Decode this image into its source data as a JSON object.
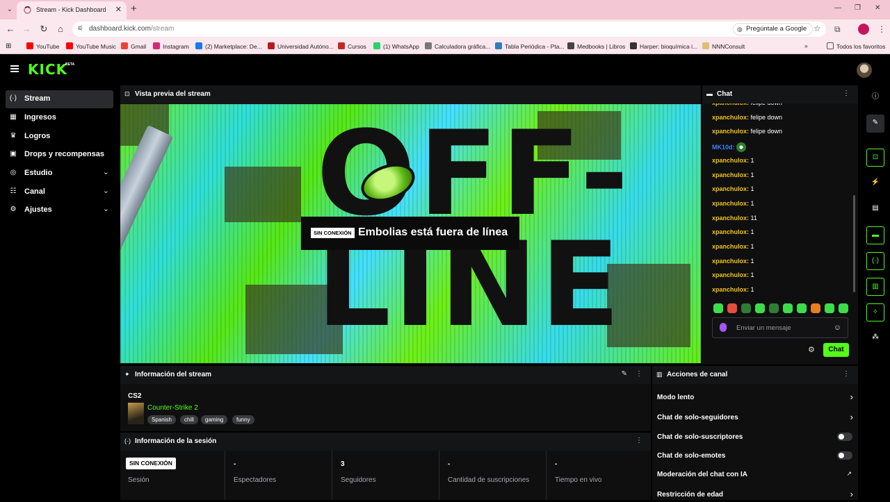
{
  "browser": {
    "tab_title": "Stream - Kick Dashboard",
    "url_host": "dashboard.kick.com",
    "url_path": "/stream",
    "ask_google": "Pregúntale a Google",
    "bookmarks": [
      {
        "label": "YouTube",
        "color": "#ff0000"
      },
      {
        "label": "YouTube Music",
        "color": "#ff0000"
      },
      {
        "label": "Gmail",
        "color": "#ea4335"
      },
      {
        "label": "Instagram",
        "color": "#d62976"
      },
      {
        "label": "(2) Marketplace: De...",
        "color": "#1877f2"
      },
      {
        "label": "Universidad Autóno...",
        "color": "#b71c1c"
      },
      {
        "label": "Cursos",
        "color": "#c62828"
      },
      {
        "label": "(1) WhatsApp",
        "color": "#25d366"
      },
      {
        "label": "Calculadora gráfica...",
        "color": "#777777"
      },
      {
        "label": "Tabla Periódica - Pta...",
        "color": "#2e7dbf"
      },
      {
        "label": "Medbooks | Libros",
        "color": "#444444"
      },
      {
        "label": "Harper: bioquímica i...",
        "color": "#333333"
      },
      {
        "label": "NNNConsult",
        "color": "#e0c070"
      }
    ],
    "all_bookmarks": "Todos los favoritos"
  },
  "app": {
    "logo": "KICK",
    "logo_badge": "BETA",
    "accent": "#53fc18"
  },
  "sidebar": {
    "items": [
      {
        "label": "Stream",
        "icon": "broadcast-icon",
        "glyph": "(·)"
      },
      {
        "label": "Ingresos",
        "icon": "wallet-icon",
        "glyph": "▦"
      },
      {
        "label": "Logros",
        "icon": "trophy-icon",
        "glyph": "♛"
      },
      {
        "label": "Drops y recompensas",
        "icon": "gift-icon",
        "glyph": "▣"
      },
      {
        "label": "Estudio",
        "icon": "studio-icon",
        "glyph": "◎"
      },
      {
        "label": "Canal",
        "icon": "channel-icon",
        "glyph": "☷"
      },
      {
        "label": "Ajustes",
        "icon": "gear-icon",
        "glyph": "⚙"
      }
    ]
  },
  "preview": {
    "title": "Vista previa del stream",
    "bg_text": "OFF-LINE",
    "badge": "SIN CONEXIÓN",
    "message": "Embolias está fuera de línea"
  },
  "chat": {
    "title": "Chat",
    "messages": [
      {
        "user": "xpanchulox:",
        "text": "felipe down",
        "color": "gold"
      },
      {
        "user": "xpanchulox:",
        "text": "felipe down",
        "color": "gold"
      },
      {
        "user": "xpanchulox:",
        "text": "felipe down",
        "color": "gold"
      },
      {
        "user": "MK10d:",
        "text": "",
        "color": "blue",
        "emote": true
      },
      {
        "user": "xpanchulox:",
        "text": "1",
        "color": "gold"
      },
      {
        "user": "xpanchulox:",
        "text": "1",
        "color": "gold"
      },
      {
        "user": "xpanchulox:",
        "text": "1",
        "color": "gold"
      },
      {
        "user": "xpanchulox:",
        "text": "1",
        "color": "gold"
      },
      {
        "user": "xpanchulox:",
        "text": "11",
        "color": "gold"
      },
      {
        "user": "xpanchulox:",
        "text": "1",
        "color": "gold"
      },
      {
        "user": "xpanchulox:",
        "text": "1",
        "color": "gold"
      },
      {
        "user": "xpanchulox:",
        "text": "1",
        "color": "gold"
      },
      {
        "user": "xpanchulox:",
        "text": "1",
        "color": "gold"
      },
      {
        "user": "xpanchulox:",
        "text": "1",
        "color": "gold"
      }
    ],
    "placeholder": "Enviar un mensaje",
    "send_label": "Chat"
  },
  "stream_info": {
    "title": "Información del stream",
    "category": "CS2",
    "game": "Counter-Strike 2",
    "tags": [
      "Spanish",
      "chill",
      "gaming",
      "funny"
    ]
  },
  "session": {
    "title": "Información de la sesión",
    "status_badge": "SIN CONEXIÓN",
    "status_label": "Sesión",
    "stats": [
      {
        "value": "-",
        "label": "Espectadores"
      },
      {
        "value": "3",
        "label": "Seguidores"
      },
      {
        "value": "-",
        "label": "Cantidad de suscripciones"
      },
      {
        "value": "-",
        "label": "Tiempo en vivo"
      }
    ]
  },
  "channel_actions": {
    "title": "Acciones de canal",
    "items": [
      {
        "label": "Modo lento",
        "control": "chevron"
      },
      {
        "label": "Chat de solo-seguidores",
        "control": "chevron"
      },
      {
        "label": "Chat de solo-suscriptores",
        "control": "toggle",
        "on": false
      },
      {
        "label": "Chat de solo-emotes",
        "control": "toggle",
        "on": false
      },
      {
        "label": "Moderación del chat con IA",
        "control": "external"
      },
      {
        "label": "Restricción de edad",
        "control": "chevron"
      }
    ]
  }
}
